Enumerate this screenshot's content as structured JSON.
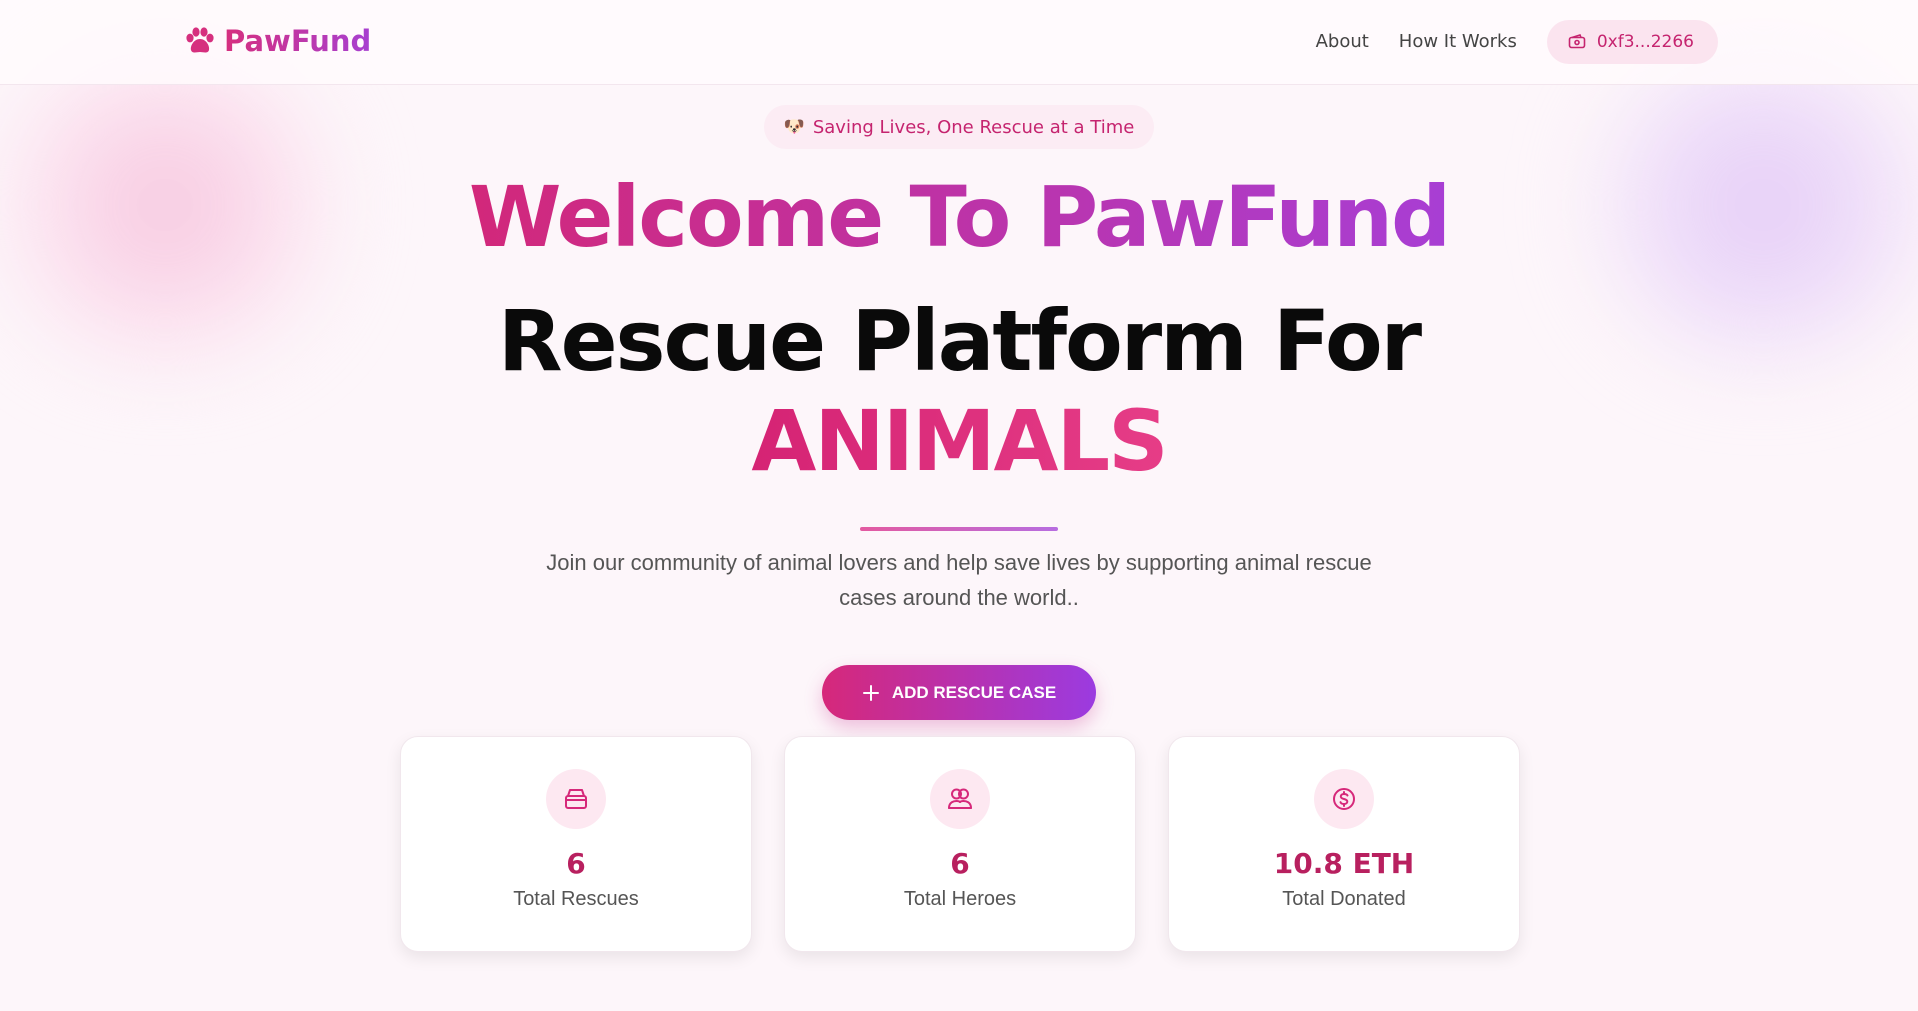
{
  "header": {
    "brand": "PawFund",
    "nav": [
      "About",
      "How It Works"
    ],
    "wallet": "0xf3...2266"
  },
  "hero": {
    "tagline_emoji": "🐶",
    "tagline": "Saving Lives, One Rescue at a Time",
    "title_line1": "Welcome To PawFund",
    "title_line2": "Rescue Platform For",
    "title_line3": "ANIMALS",
    "subtitle": "Join our community of animal lovers and help save lives by supporting animal rescue cases around the world..",
    "cta_label": "ADD RESCUE CASE"
  },
  "stats": [
    {
      "value": "6",
      "label": "Total Rescues",
      "icon": "box-icon"
    },
    {
      "value": "6",
      "label": "Total Heroes",
      "icon": "users-icon"
    },
    {
      "value": "10.8 ETH",
      "label": "Total Donated",
      "icon": "dollar-circle-icon"
    }
  ],
  "colors": {
    "accent_pink": "#d6287a",
    "accent_purple": "#9b3be0",
    "stat_value": "#b8205f"
  }
}
